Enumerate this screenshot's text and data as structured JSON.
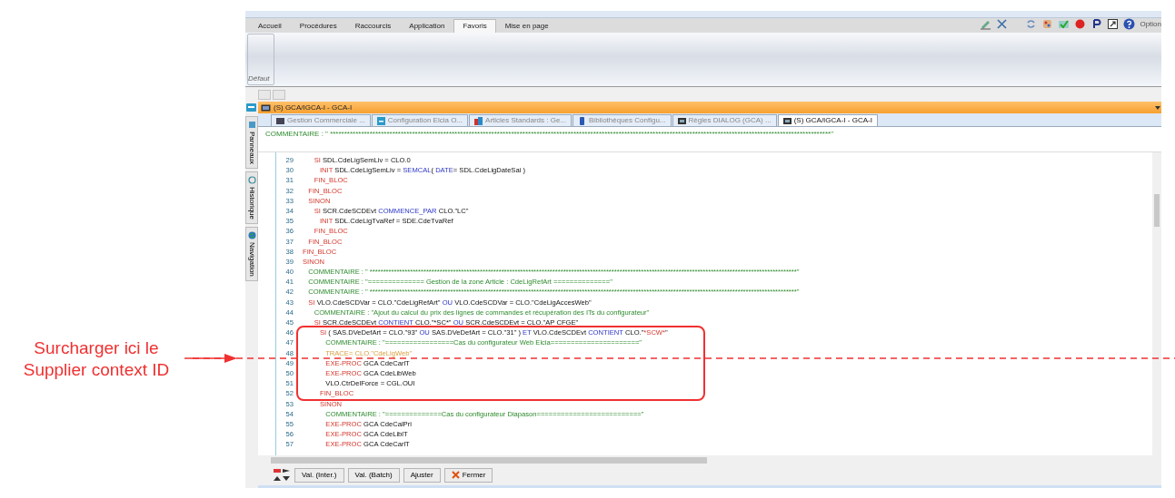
{
  "ribbon": {
    "tabs": [
      {
        "label": "Accueil",
        "selected": false
      },
      {
        "label": "Procédures",
        "selected": false
      },
      {
        "label": "Raccourcis",
        "selected": false
      },
      {
        "label": "Application",
        "selected": false
      },
      {
        "label": "Favoris",
        "selected": true
      },
      {
        "label": "Mise en page",
        "selected": false
      }
    ],
    "options_label": "Option",
    "group_label": "Défaut"
  },
  "panel_title": "(S) GCA/IGCA-I - GCA-I",
  "side_tabs": [
    {
      "label": "Panneaux"
    },
    {
      "label": "Historique"
    },
    {
      "label": "Navigation"
    }
  ],
  "doc_tabs": [
    {
      "label": "Gestion Commerciale ...",
      "selected": false
    },
    {
      "label": "Configuration Elcia O...",
      "selected": false
    },
    {
      "label": "Articles Standards : Ge...",
      "selected": false
    },
    {
      "label": "Bibliothèques Configu...",
      "selected": false
    },
    {
      "label": "Règles DIALOG (GCA) ...",
      "selected": false
    },
    {
      "label": "(S) GCA/IGCA-I - GCA-I",
      "selected": true
    }
  ],
  "header_comment": "COMMENTAIRE : \" *********************************************************************************************************************************************************************************\"",
  "code_lines": [
    {
      "number": "29",
      "tokens": [
        {
          "kind": "kw",
          "text": "      SI"
        },
        {
          "kind": "id",
          "text": " SDL.CdeLigSemLiv = CLO.0"
        }
      ]
    },
    {
      "number": "30",
      "tokens": [
        {
          "kind": "kw",
          "text": "         INIT"
        },
        {
          "kind": "id",
          "text": " SDL.CdeLigSemLiv = "
        },
        {
          "kind": "fn",
          "text": "SEMCAL"
        },
        {
          "kind": "id",
          "text": "( "
        },
        {
          "kind": "fn",
          "text": "DATE"
        },
        {
          "kind": "id",
          "text": "= SDL.CdeLigDateSai )"
        }
      ]
    },
    {
      "number": "31",
      "tokens": [
        {
          "kind": "kw",
          "text": "      FIN_BLOC"
        }
      ]
    },
    {
      "number": "32",
      "tokens": [
        {
          "kind": "kw",
          "text": "   FIN_BLOC"
        }
      ]
    },
    {
      "number": "33",
      "tokens": [
        {
          "kind": "kw",
          "text": "   SINON"
        }
      ]
    },
    {
      "number": "34",
      "tokens": [
        {
          "kind": "kw",
          "text": "      SI"
        },
        {
          "kind": "id",
          "text": " SCR.CdeSCDEvt "
        },
        {
          "kind": "fn",
          "text": "COMMENCE_PAR"
        },
        {
          "kind": "id",
          "text": " CLO.\"LC\""
        }
      ]
    },
    {
      "number": "35",
      "tokens": [
        {
          "kind": "kw",
          "text": "         INIT"
        },
        {
          "kind": "id",
          "text": " SDL.CdeLigTvaRef = SDE.CdeTvaRef"
        }
      ]
    },
    {
      "number": "36",
      "tokens": [
        {
          "kind": "kw",
          "text": "      FIN_BLOC"
        }
      ]
    },
    {
      "number": "37",
      "tokens": [
        {
          "kind": "kw",
          "text": "   FIN_BLOC"
        }
      ]
    },
    {
      "number": "38",
      "tokens": [
        {
          "kind": "kw",
          "text": "FIN_BLOC"
        }
      ]
    },
    {
      "number": "39",
      "tokens": [
        {
          "kind": "kw",
          "text": "SINON"
        }
      ]
    },
    {
      "number": "40",
      "tokens": [
        {
          "kind": "cm",
          "text": "   COMMENTAIRE : \" ***************************************************************************************************************************************************************\""
        }
      ]
    },
    {
      "number": "41",
      "tokens": [
        {
          "kind": "cm",
          "text": "   COMMENTAIRE : \"============== Gestion de la zone Article : CdeLigRefArt ==============\""
        }
      ]
    },
    {
      "number": "42",
      "tokens": [
        {
          "kind": "cm",
          "text": "   COMMENTAIRE : \" ***************************************************************************************************************************************************************\""
        }
      ]
    },
    {
      "number": "43",
      "tokens": [
        {
          "kind": "kw",
          "text": "   SI"
        },
        {
          "kind": "id",
          "text": " VLO.CdeSCDVar = CLO.\"CdeLigRefArt\" "
        },
        {
          "kind": "fn",
          "text": "OU"
        },
        {
          "kind": "id",
          "text": " VLO.CdeSCDVar = CLO.\"CdeLigAccesWeb\""
        }
      ]
    },
    {
      "number": "44",
      "tokens": [
        {
          "kind": "cm",
          "text": "      COMMENTAIRE : \"Ajout du calcul du prix des lignes de commandes et récupération des ITs du configurateur\""
        }
      ]
    },
    {
      "number": "45",
      "tokens": [
        {
          "kind": "kw",
          "text": "      SI"
        },
        {
          "kind": "id",
          "text": " SCR.CdeSCDEvt "
        },
        {
          "kind": "fn",
          "text": "CONTIENT"
        },
        {
          "kind": "id",
          "text": " CLO.\"*SC*\" "
        },
        {
          "kind": "fn",
          "text": "OU"
        },
        {
          "kind": "id",
          "text": " SCR.CdeSCDEvt = CLO.\"AP CFGE\""
        }
      ]
    },
    {
      "number": "46",
      "tokens": [
        {
          "kind": "kw",
          "text": "         SI"
        },
        {
          "kind": "id",
          "text": " ( SAS.DVeDefArt = CLO.\"93\" "
        },
        {
          "kind": "fn",
          "text": "OU"
        },
        {
          "kind": "id",
          "text": " SAS.DVeDefArt = CLO.\"31\" ) "
        },
        {
          "kind": "fn",
          "text": "ET"
        },
        {
          "kind": "id",
          "text": " VLO.CdeSCDEvt "
        },
        {
          "kind": "fn",
          "text": "CONTIENT"
        },
        {
          "kind": "id",
          "text": " CLO.\""
        },
        {
          "kind": "kw",
          "text": "*SCW*"
        },
        {
          "kind": "id",
          "text": "\""
        }
      ]
    },
    {
      "number": "47",
      "tokens": [
        {
          "kind": "cm",
          "text": "            COMMENTAIRE : \"=================Cas du configurateur Web Elcia======================\""
        }
      ]
    },
    {
      "number": "48",
      "tokens": [
        {
          "kind": "tr",
          "text": "            TRACE= CLO.\"CdeLigWeb\""
        }
      ]
    },
    {
      "number": "49",
      "tokens": [
        {
          "kind": "kw",
          "text": "            EXE-PROC"
        },
        {
          "kind": "id",
          "text": " GCA CdeCarlT"
        }
      ]
    },
    {
      "number": "50",
      "tokens": [
        {
          "kind": "kw",
          "text": "            EXE-PROC"
        },
        {
          "kind": "id",
          "text": " GCA CdeLibWeb"
        }
      ]
    },
    {
      "number": "51",
      "tokens": [
        {
          "kind": "id",
          "text": "            VLO.CtrDelForce = CGL.OUI"
        }
      ]
    },
    {
      "number": "52",
      "tokens": [
        {
          "kind": "kw",
          "text": "         FIN_BLOC"
        }
      ]
    },
    {
      "number": "53",
      "tokens": [
        {
          "kind": "kw",
          "text": "         SINON"
        }
      ]
    },
    {
      "number": "54",
      "tokens": [
        {
          "kind": "cm",
          "text": "            COMMENTAIRE : \"==============Cas du configurateur Diapason==========================\""
        }
      ]
    },
    {
      "number": "55",
      "tokens": [
        {
          "kind": "kw",
          "text": "            EXE-PROC"
        },
        {
          "kind": "id",
          "text": " GCA CdeCalPri"
        }
      ]
    },
    {
      "number": "56",
      "tokens": [
        {
          "kind": "kw",
          "text": "            EXE-PROC"
        },
        {
          "kind": "id",
          "text": " GCA CdeLiblT"
        }
      ]
    },
    {
      "number": "57",
      "tokens": [
        {
          "kind": "kw",
          "text": "            EXE-PROC"
        },
        {
          "kind": "id",
          "text": " GCA CdeCarlT"
        }
      ]
    }
  ],
  "bottom_buttons": [
    {
      "label": "Val. (Inter.)",
      "kind": "plain"
    },
    {
      "label": "Val. (Batch)",
      "kind": "plain"
    },
    {
      "label": "Ajuster",
      "kind": "plain"
    },
    {
      "label": "Fermer",
      "kind": "close"
    }
  ],
  "annotation": {
    "text": "Surcharger ici le Supplier context ID"
  }
}
